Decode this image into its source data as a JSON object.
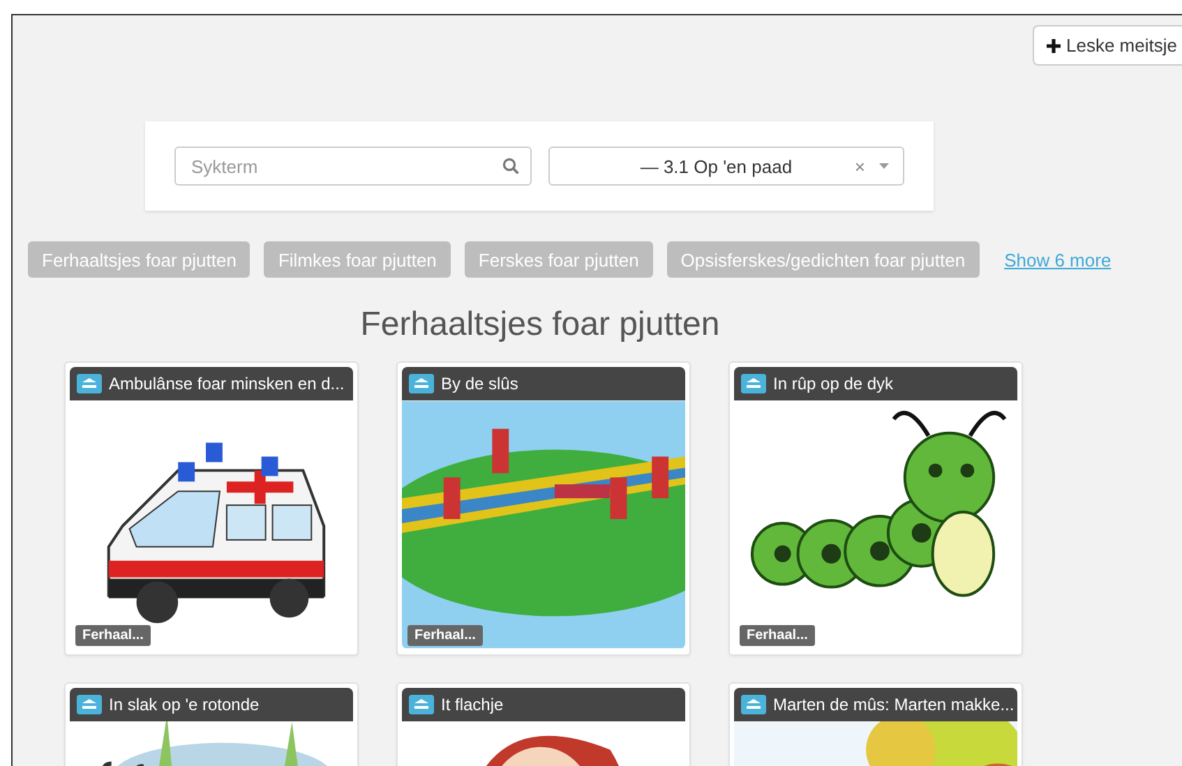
{
  "toolbar": {
    "add_button": "Leske meitsje"
  },
  "search": {
    "placeholder": "Sykterm",
    "selected_value": "— 3.1 Op 'en paad",
    "clear": "×"
  },
  "filters": [
    {
      "label": "Ferhaaltsjes foar pjutten"
    },
    {
      "label": "Filmkes foar pjutten"
    },
    {
      "label": "Ferskes foar pjutten"
    },
    {
      "label": "Opsisferskes/gedichten foar pjutten"
    }
  ],
  "show_more": "Show 6 more",
  "section_title": "Ferhaaltsjes foar pjutten",
  "cards": [
    {
      "title": "Ambulânse foar minsken en d...",
      "tag": "Ferhaal..."
    },
    {
      "title": "By de slûs",
      "tag": "Ferhaal..."
    },
    {
      "title": "In rûp op de dyk",
      "tag": "Ferhaal..."
    },
    {
      "title": "In slak op 'e rotonde"
    },
    {
      "title": "It flachje"
    },
    {
      "title": "Marten de mûs: Marten makke..."
    }
  ]
}
